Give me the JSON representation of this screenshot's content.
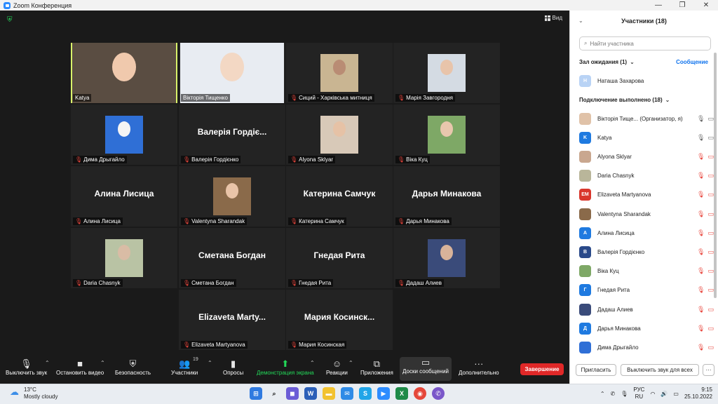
{
  "window": {
    "title": "Zoom Конференция",
    "controls": [
      "—",
      "❐",
      "✕"
    ]
  },
  "video": {
    "view_label": "Вид",
    "tiles": [
      {
        "id": "t1",
        "caption": "Katya",
        "muted": false,
        "active": true,
        "photo": true,
        "bg": "#5a4d42",
        "face": "#f0c9ad"
      },
      {
        "id": "t2",
        "caption": "Вікторія Тищенко",
        "muted": false,
        "photo": true,
        "bg": "#e8ecf2",
        "face": "#f3d8c4"
      },
      {
        "id": "t3",
        "caption": "Сиций - Харківська митниця",
        "muted": true,
        "photo": true,
        "bg": "#c9b592",
        "face": "#b98c74"
      },
      {
        "id": "t4",
        "caption": "Марія Завгородня",
        "muted": true,
        "photo": true,
        "bg": "#d4dbe3",
        "face": "#e8c4aa"
      },
      {
        "id": "t5",
        "caption": "Дима Дрыгайло",
        "muted": true,
        "photo": true,
        "bg": "#2f6fd6",
        "face": "#f4f4f4"
      },
      {
        "id": "t6",
        "caption": "Валерія Гордієнко",
        "muted": true,
        "name": "Валерія Гордіє...",
        "photo": false
      },
      {
        "id": "t7",
        "caption": "Alyona Sklyar",
        "muted": true,
        "photo": true,
        "bg": "#d8c9b8",
        "face": "#e6c2a6"
      },
      {
        "id": "t8",
        "caption": "Віка Куц",
        "muted": true,
        "photo": true,
        "bg": "#7ea866",
        "face": "#e8c7ad"
      },
      {
        "id": "t9",
        "caption": "Алина Лисица",
        "muted": true,
        "name": "Алина Лисица",
        "photo": false
      },
      {
        "id": "t10",
        "caption": "Valentyna Sharandak",
        "muted": true,
        "photo": true,
        "bg": "#8a6a4a",
        "face": "#e9c4a8"
      },
      {
        "id": "t11",
        "caption": "Катерина Самчук",
        "muted": true,
        "name": "Катерина Самчук",
        "photo": false
      },
      {
        "id": "t12",
        "caption": "Дарья Минакова",
        "muted": true,
        "name": "Дарья Минакова",
        "photo": false
      },
      {
        "id": "t13",
        "caption": "Daria Chasnyk",
        "muted": true,
        "photo": true,
        "bg": "#b9c3a4",
        "face": "#d9bca5"
      },
      {
        "id": "t14",
        "caption": "Сметана Богдан",
        "muted": true,
        "name": "Сметана Богдан",
        "photo": false
      },
      {
        "id": "t15",
        "caption": "Гнедая Рита",
        "muted": true,
        "name": "Гнедая Рита",
        "photo": false
      },
      {
        "id": "t16",
        "caption": "Дадаш Алиев",
        "muted": true,
        "photo": true,
        "bg": "#3a4b7a",
        "face": "#d8b39a"
      },
      {
        "id": "t17",
        "caption": "Elizaveta Martyanova",
        "muted": true,
        "name": "Elizaveta  Marty...",
        "photo": false
      },
      {
        "id": "t18",
        "caption": "Мария Косинская",
        "muted": true,
        "name": "Мария  Косинск...",
        "photo": false
      }
    ]
  },
  "toolbar": {
    "mute": "Выключить звук",
    "video": "Остановить видео",
    "security": "Безопасность",
    "participants": "Участники",
    "participants_count": "19",
    "polls": "Опросы",
    "share": "Демонстрация экрана",
    "reactions": "Реакции",
    "apps": "Приложения",
    "whiteboard": "Доски сообщений",
    "more": "Дополнительно",
    "end": "Завершение"
  },
  "panel": {
    "title": "Участники (18)",
    "search_placeholder": "Найти участника",
    "waiting_label": "Зал ожидания (1)",
    "admit_label": "Сообщение",
    "waiting": [
      {
        "name": "Наташа Захарова",
        "initials": "Н",
        "color": "#b9d3f5"
      }
    ],
    "connected_label": "Подключение выполнено (18)",
    "participants": [
      {
        "name": "Вікторія Тище...  (Организатор, я)",
        "initials": "",
        "color": "#e0c2a8",
        "photo": true,
        "mic_ok": true
      },
      {
        "name": "Katya",
        "initials": "K",
        "color": "#1f7ae0",
        "photo": false,
        "mic_ok": true
      },
      {
        "name": "Alyona Sklyar",
        "initials": "",
        "color": "#c9a78f",
        "photo": true,
        "mic_ok": false
      },
      {
        "name": "Daria Chasnyk",
        "initials": "",
        "color": "#b9b69a",
        "photo": true,
        "mic_ok": false
      },
      {
        "name": "Elizaveta Martyanova",
        "initials": "EM",
        "color": "#d9372c",
        "photo": false,
        "mic_ok": false
      },
      {
        "name": "Valentyna Sharandak",
        "initials": "",
        "color": "#8a6a4a",
        "photo": true,
        "mic_ok": false
      },
      {
        "name": "Алина Лисица",
        "initials": "А",
        "color": "#1f7ae0",
        "photo": false,
        "mic_ok": false
      },
      {
        "name": "Валерія Гордієнко",
        "initials": "В",
        "color": "#2b4a8a",
        "photo": false,
        "mic_ok": false
      },
      {
        "name": "Віка Куц",
        "initials": "",
        "color": "#7ea866",
        "photo": true,
        "mic_ok": false
      },
      {
        "name": "Гнедая Рита",
        "initials": "Г",
        "color": "#1f7ae0",
        "photo": false,
        "mic_ok": false
      },
      {
        "name": "Дадаш Алиев",
        "initials": "",
        "color": "#3a4b7a",
        "photo": true,
        "mic_ok": false
      },
      {
        "name": "Дарья Минакова",
        "initials": "Д",
        "color": "#1f7ae0",
        "photo": false,
        "mic_ok": false
      },
      {
        "name": "Дима Дрыгайло",
        "initials": "",
        "color": "#2f6fd6",
        "photo": true,
        "mic_ok": false
      }
    ],
    "invite_label": "Пригласить",
    "mute_all_label": "Выключить звук для всех",
    "more_label": "···"
  },
  "taskbar": {
    "temp": "13°C",
    "weather": "Mostly cloudy",
    "lang_top": "РУС",
    "lang_bottom": "RU",
    "time": "9:15",
    "date": "25.10.2022"
  }
}
